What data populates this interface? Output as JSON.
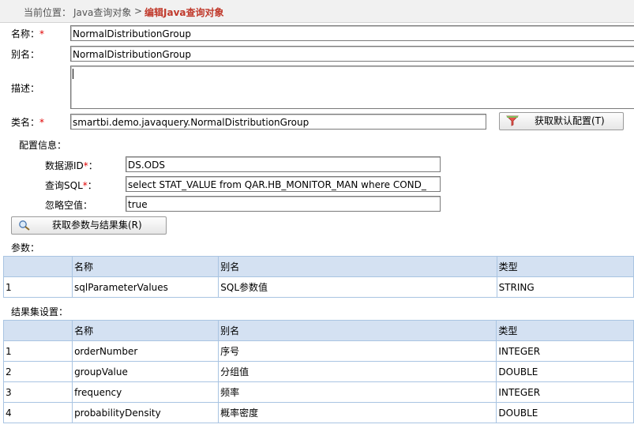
{
  "breadcrumb": {
    "prefix": "当前位置：",
    "parent": "Java查询对象",
    "separator": ">",
    "current": "编辑Java查询对象"
  },
  "form": {
    "name_label": "名称：",
    "name_value": "NormalDistributionGroup",
    "alias_label": "别名：",
    "alias_value": "NormalDistributionGroup",
    "desc_label": "描述：",
    "desc_value": "",
    "class_label": "类名：",
    "class_value": "smartbi.demo.javaquery.NormalDistributionGroup",
    "required_mark": "*",
    "default_config_button": "获取默认配置(T)"
  },
  "config": {
    "section_label": "配置信息：",
    "datasource_label": "数据源ID",
    "datasource_value": "DS.ODS",
    "query_label": "查询SQL",
    "query_value": "select STAT_VALUE from QAR.HB_MONITOR_MAN where COND_",
    "ignore_label": "忽略空值：",
    "ignore_value": "true",
    "colon": "："
  },
  "fetch_button": "获取参数与结果集(R)",
  "params": {
    "section_label": "参数：",
    "headers": [
      "",
      "名称",
      "别名",
      "类型"
    ],
    "rows": [
      [
        "1",
        "sqlParameterValues",
        "SQL参数值",
        "STRING"
      ]
    ]
  },
  "resultset": {
    "section_label": "结果集设置：",
    "headers": [
      "",
      "名称",
      "别名",
      "类型"
    ],
    "rows": [
      [
        "1",
        "orderNumber",
        "序号",
        "INTEGER"
      ],
      [
        "2",
        "groupValue",
        "分组值",
        "DOUBLE"
      ],
      [
        "3",
        "frequency",
        "频率",
        "INTEGER"
      ],
      [
        "4",
        "probabilityDensity",
        "概率密度",
        "DOUBLE"
      ]
    ]
  },
  "colors": {
    "breadcrumb_current": "#c0392b",
    "grid_header": "#d4e1f2",
    "grid_border": "#a9c4e2"
  },
  "icons": {
    "default_config": "funnel-icon",
    "fetch": "magnifier-icon"
  }
}
